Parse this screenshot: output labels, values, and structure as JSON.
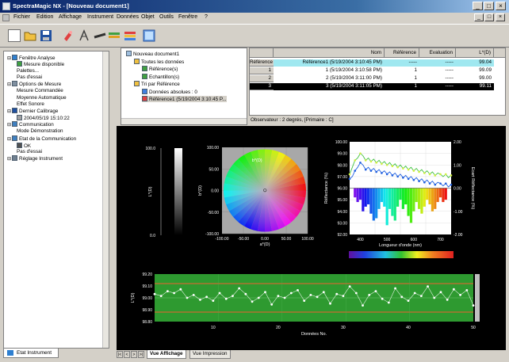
{
  "window": {
    "title": "SpectraMagic NX - [Nouveau document1]",
    "controls": [
      "_",
      "□",
      "×"
    ]
  },
  "menu": {
    "items": [
      "Fichier",
      "Edition",
      "Affichage",
      "Instrument",
      "Données",
      "Objet",
      "Outils",
      "Fenêtre",
      "?"
    ]
  },
  "toolbar": {
    "buttons": [
      "new-icon",
      "open-icon",
      "save-icon",
      "measure-icon",
      "calibrate-icon",
      "compare-icon",
      "color-icon",
      "export-icon",
      "window-icon"
    ]
  },
  "instrument_panel": {
    "nodes": [
      {
        "label": "Fenêtre Analyse",
        "level": 0,
        "icon": "window-icon"
      },
      {
        "label": "Mesure disponible",
        "level": 1,
        "icon": "check-icon"
      },
      {
        "label": "Palettes...",
        "level": 1,
        "icon": ""
      },
      {
        "label": "Pas d'essai",
        "level": 1,
        "icon": ""
      },
      {
        "label": "Options de Mesure",
        "level": 0,
        "icon": "options-icon"
      },
      {
        "label": "Mesure Commandée",
        "level": 1,
        "icon": ""
      },
      {
        "label": "Moyenne Automatique",
        "level": 1,
        "icon": ""
      },
      {
        "label": "Effet Sonore",
        "level": 1,
        "icon": ""
      },
      {
        "label": "Dernier Calibrage",
        "level": 0,
        "icon": "calibration-icon"
      },
      {
        "label": "2004/05/19 15:10:22",
        "level": 1,
        "icon": "clock-icon"
      },
      {
        "label": "Communication",
        "level": 0,
        "icon": "communication-icon"
      },
      {
        "label": "Mode Démonstration",
        "level": 1,
        "icon": ""
      },
      {
        "label": "Etat de la Communication",
        "level": 0,
        "icon": "status-icon"
      },
      {
        "label": "OK",
        "level": 1,
        "icon": "ok-icon"
      },
      {
        "label": "Pas d'essai",
        "level": 1,
        "icon": ""
      },
      {
        "label": "Réglage Instrument",
        "level": 0,
        "icon": "settings-icon"
      }
    ],
    "tab_label": "Etat Instrument"
  },
  "document_tree": {
    "nodes": [
      {
        "label": "Nouveau document1",
        "level": 0
      },
      {
        "label": "Toutes les données",
        "level": 1
      },
      {
        "label": "Référence(s)",
        "level": 2
      },
      {
        "label": "Echantillon(s)",
        "level": 2
      },
      {
        "label": "Tri par Référence",
        "level": 1
      },
      {
        "label": "Données absolues : 0",
        "level": 2
      },
      {
        "label": "Référence1 (5/19/2004 3:10:45 P...",
        "level": 2
      }
    ]
  },
  "data_grid": {
    "headers": [
      "Nom",
      "Référence",
      "Evaluation",
      "L*(D)"
    ],
    "rows": [
      {
        "rh": "Référence",
        "nom": "Référence1 (5/19/2004 3:10:45 PM)",
        "ref": "-----",
        "eval": "-----",
        "l": "99.04",
        "style": "ref"
      },
      {
        "rh": "1",
        "nom": "1 (5/19/2004 3:10:58 PM)",
        "ref": "1",
        "eval": "-----",
        "l": "99.09",
        "style": "normal"
      },
      {
        "rh": "2",
        "nom": "2 (5/19/2004 3:11:00 PM)",
        "ref": "1",
        "eval": "-----",
        "l": "99.00",
        "style": "normal"
      },
      {
        "rh": "3",
        "nom": "3 (5/19/2004 3:11:05 PM)",
        "ref": "1",
        "eval": "-----",
        "l": "99.11",
        "style": "selected"
      }
    ],
    "status": "Observateur : 2 degrés, [Primaire : C]"
  },
  "bottom_tabs": [
    "Vue Affichage",
    "Vue Impression"
  ],
  "charts": {
    "lightness": {
      "axis_label": "L*(D)",
      "range": [
        0,
        100
      ]
    },
    "color_plane": {
      "xlabel": "a*(D)",
      "ylabel": "b*(D)",
      "x_ticks": [
        "-100.00",
        "-50.00",
        "0.00",
        "50.00",
        "100.00"
      ],
      "y_ticks": [
        "100.00",
        "50.00",
        "0.00",
        "-50.00",
        "-100.00"
      ]
    },
    "spectral": {
      "xlabel": "Longueur d'onde (nm)",
      "ylabel": "Réflectance (%)",
      "y2label": "Ecart Réflectance (%)",
      "x_ticks": [
        "400",
        "500",
        "600",
        "700"
      ],
      "y_ticks": [
        "100.00",
        "99.00",
        "98.00",
        "97.00",
        "96.00",
        "95.00",
        "94.00",
        "93.00",
        "92.00"
      ],
      "y2_ticks": [
        "2.00",
        "1.00",
        "0.00",
        "-1.00",
        "-2.00"
      ]
    },
    "trend": {
      "xlabel": "Données No.",
      "ylabel": "L*(D)",
      "x_ticks": [
        "10",
        "20",
        "30",
        "40",
        "50"
      ],
      "y_ticks": [
        "99.20",
        "99.10",
        "99.00",
        "98.90",
        "98.80"
      ]
    }
  },
  "chart_data": [
    {
      "type": "scatter",
      "title": "",
      "xlabel": "a*(D)",
      "ylabel": "b*(D)",
      "xlim": [
        -100,
        100
      ],
      "ylim": [
        -100,
        100
      ],
      "grid": true,
      "series": [
        {
          "x": [
            0.4
          ],
          "y": [
            0.6
          ]
        }
      ]
    },
    {
      "type": "line",
      "xlabel": "Longueur d'onde (nm)",
      "ylabel": "Réflectance (%)",
      "xlim": [
        360,
        740
      ],
      "ylim": [
        92,
        100
      ],
      "x": [
        360,
        370,
        380,
        390,
        400,
        410,
        420,
        430,
        440,
        450,
        460,
        470,
        480,
        490,
        500,
        510,
        520,
        530,
        540,
        550,
        560,
        570,
        580,
        590,
        600,
        610,
        620,
        630,
        640,
        650,
        660,
        670,
        680,
        690,
        700,
        710,
        720,
        730,
        740
      ],
      "series": [
        {
          "values": [
            97.2,
            97.8,
            98.4,
            98.6,
            99.0,
            98.8,
            98.4,
            98.6,
            98.3,
            98.5,
            98.2,
            98.4,
            98.1,
            98.3,
            98.0,
            98.2,
            97.9,
            98.1,
            97.8,
            98.0,
            97.7,
            97.9,
            97.6,
            97.8,
            97.5,
            97.7,
            97.4,
            97.6,
            97.3,
            97.5,
            97.2,
            97.4,
            97.1,
            97.3,
            97.2,
            97.0,
            97.2,
            96.9,
            97.1
          ]
        },
        {
          "values": [
            96.8,
            97.0,
            97.5,
            97.8,
            98.2,
            98.0,
            97.6,
            97.8,
            97.5,
            97.7,
            97.4,
            97.6,
            97.3,
            97.5,
            97.2,
            97.4,
            97.1,
            97.3,
            97.0,
            97.2,
            96.9,
            97.1,
            96.8,
            97.0,
            96.7,
            96.9,
            96.6,
            96.8,
            96.5,
            96.7,
            96.4,
            96.6,
            96.3,
            96.5,
            96.4,
            96.2,
            96.4,
            96.1,
            96.3
          ]
        }
      ]
    },
    {
      "type": "bar",
      "ylabel": "Ecart Réflectance (%)",
      "ylim": [
        -2,
        2
      ],
      "x": [
        380,
        390,
        400,
        410,
        420,
        430,
        440,
        450,
        460,
        470,
        480,
        490,
        500,
        510,
        520,
        530,
        540,
        550,
        560,
        570,
        580,
        590,
        600,
        610,
        620,
        630,
        640,
        650,
        660,
        670,
        680,
        690,
        700,
        710,
        720
      ],
      "values": [
        -0.4,
        -0.6,
        -0.5,
        -1.0,
        -0.8,
        -0.7,
        -1.1,
        -1.4,
        -1.3,
        -0.9,
        -0.6,
        -0.8,
        -1.6,
        -0.9,
        -1.2,
        -1.4,
        -0.8,
        -0.5,
        -0.9,
        -0.7,
        -1.2,
        -1.5,
        -1.0,
        -0.6,
        -0.9,
        -1.1,
        -0.8,
        -0.5,
        -0.7,
        -1.0,
        -0.9,
        -0.6,
        -0.4,
        -0.6,
        -0.5
      ]
    },
    {
      "type": "line",
      "xlabel": "Données No.",
      "ylabel": "L*(D)",
      "xlim": [
        1,
        50
      ],
      "ylim": [
        98.75,
        99.25
      ],
      "x": [
        1,
        2,
        3,
        4,
        5,
        6,
        7,
        8,
        9,
        10,
        11,
        12,
        13,
        14,
        15,
        16,
        17,
        18,
        19,
        20,
        21,
        22,
        23,
        24,
        25,
        26,
        27,
        28,
        29,
        30,
        31,
        32,
        33,
        34,
        35,
        36,
        37,
        38,
        39,
        40,
        41,
        42,
        43,
        44,
        45,
        46,
        47,
        48,
        49,
        50
      ],
      "values": [
        99.04,
        99.02,
        99.07,
        99.05,
        99.09,
        99.0,
        99.03,
        98.98,
        99.01,
        98.97,
        99.05,
        98.99,
        99.02,
        99.1,
        99.04,
        98.96,
        99.0,
        99.06,
        98.93,
        99.02,
        99.0,
        99.05,
        99.08,
        98.97,
        99.03,
        99.01,
        99.06,
        98.94,
        99.04,
        99.02,
        99.12,
        99.05,
        98.92,
        99.03,
        99.07,
        98.99,
        98.95,
        99.1,
        99.01,
        98.97,
        99.05,
        99.02,
        99.12,
        99.0,
        99.06,
        98.98,
        99.09,
        99.03,
        99.08,
        98.92
      ]
    }
  ]
}
